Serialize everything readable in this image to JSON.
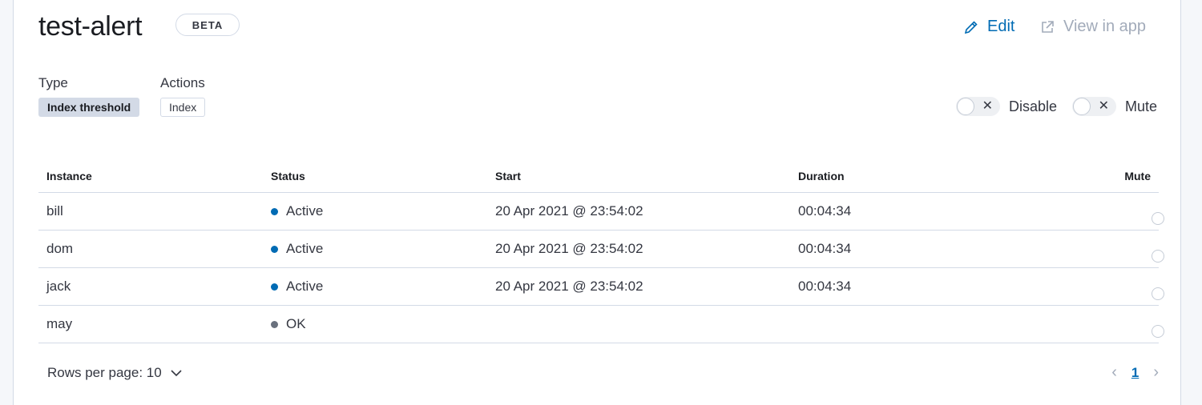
{
  "header": {
    "title": "test-alert",
    "badge": "BETA",
    "edit_label": "Edit",
    "view_label": "View in app"
  },
  "meta": {
    "type_label": "Type",
    "type_value": "Index threshold",
    "actions_label": "Actions",
    "actions_value": "Index"
  },
  "toggles": {
    "disable_label": "Disable",
    "mute_label": "Mute"
  },
  "table": {
    "columns": [
      "Instance",
      "Status",
      "Start",
      "Duration",
      "Mute"
    ],
    "rows": [
      {
        "instance": "bill",
        "status": "Active",
        "status_color": "#006bb4",
        "start": "20 Apr 2021 @ 23:54:02",
        "duration": "00:04:34"
      },
      {
        "instance": "dom",
        "status": "Active",
        "status_color": "#006bb4",
        "start": "20 Apr 2021 @ 23:54:02",
        "duration": "00:04:34"
      },
      {
        "instance": "jack",
        "status": "Active",
        "status_color": "#006bb4",
        "start": "20 Apr 2021 @ 23:54:02",
        "duration": "00:04:34"
      },
      {
        "instance": "may",
        "status": "OK",
        "status_color": "#69707d",
        "start": "",
        "duration": ""
      }
    ]
  },
  "footer": {
    "rows_per_page": "Rows per page: 10",
    "current_page": "1"
  },
  "colors": {
    "accent": "#006bb4",
    "muted": "#a2abba"
  }
}
